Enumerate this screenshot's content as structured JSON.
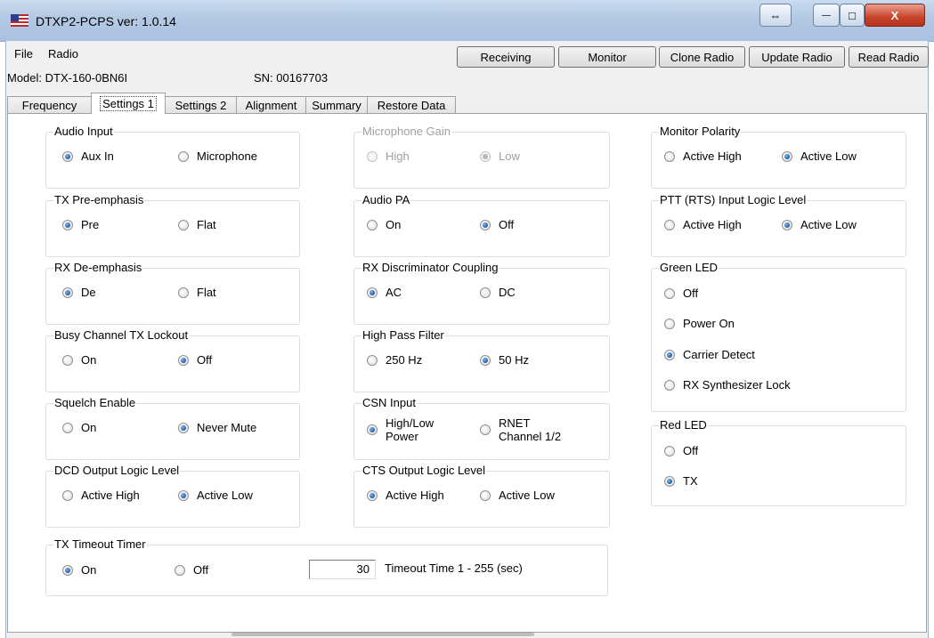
{
  "window": {
    "title": "DTXP2-PCPS ver: 1.0.14",
    "buttons": {
      "extra": "⇔",
      "minimize": "—",
      "maximize": "□",
      "close": "X"
    }
  },
  "menu": {
    "file": "File",
    "radio": "Radio"
  },
  "actions": {
    "receiving": "Receiving",
    "monitor": "Monitor",
    "clone": "Clone Radio",
    "update": "Update Radio",
    "read": "Read Radio"
  },
  "info": {
    "model": "Model: DTX-160-0BN6I",
    "sn": "SN: 00167703"
  },
  "tabs": [
    "Frequency",
    "Settings 1",
    "Settings 2",
    "Alignment",
    "Summary",
    "Restore Data"
  ],
  "groups": {
    "audio_input": {
      "label": "Audio Input",
      "options": [
        "Aux In",
        "Microphone"
      ],
      "selected": "Aux In"
    },
    "tx_preemphasis": {
      "label": "TX Pre-emphasis",
      "options": [
        "Pre",
        "Flat"
      ],
      "selected": "Pre"
    },
    "rx_deemphasis": {
      "label": "RX De-emphasis",
      "options": [
        "De",
        "Flat"
      ],
      "selected": "De"
    },
    "busy_channel": {
      "label": "Busy Channel TX Lockout",
      "options": [
        "On",
        "Off"
      ],
      "selected": "Off"
    },
    "squelch": {
      "label": "Squelch Enable",
      "options": [
        "On",
        "Never Mute"
      ],
      "selected": "Never Mute"
    },
    "dcd_output": {
      "label": "DCD Output Logic Level",
      "options": [
        "Active High",
        "Active Low"
      ],
      "selected": "Active Low"
    },
    "tx_timeout": {
      "label": "TX Timeout Timer",
      "options": [
        "On",
        "Off"
      ],
      "selected": "On",
      "value": "30",
      "value_label": "Timeout Time  1 - 255 (sec)"
    },
    "mic_gain": {
      "label": "Microphone Gain",
      "options": [
        "High",
        "Low"
      ],
      "selected": "Low",
      "disabled": true
    },
    "audio_pa": {
      "label": "Audio PA",
      "options": [
        "On",
        "Off"
      ],
      "selected": "Off"
    },
    "rx_disc": {
      "label": "RX Discriminator Coupling",
      "options": [
        "AC",
        "DC"
      ],
      "selected": "AC"
    },
    "hpf": {
      "label": "High Pass Filter",
      "options": [
        "250 Hz",
        "50 Hz"
      ],
      "selected": "50 Hz"
    },
    "csn_input": {
      "label": "CSN Input",
      "options": [
        "High/Low Power",
        "RNET Channel 1/2"
      ],
      "selected": "High/Low Power"
    },
    "cts_output": {
      "label": "CTS Output Logic Level",
      "options": [
        "Active High",
        "Active Low"
      ],
      "selected": "Active High"
    },
    "monitor_polarity": {
      "label": "Monitor Polarity",
      "options": [
        "Active High",
        "Active Low"
      ],
      "selected": "Active Low"
    },
    "ptt_input": {
      "label": "PTT (RTS) Input Logic Level",
      "options": [
        "Active High",
        "Active Low"
      ],
      "selected": "Active Low"
    },
    "green_led": {
      "label": "Green LED",
      "options": [
        "Off",
        "Power On",
        "Carrier Detect",
        "RX Synthesizer Lock"
      ],
      "selected": "Carrier Detect"
    },
    "red_led": {
      "label": "Red LED",
      "options": [
        "Off",
        "TX"
      ],
      "selected": "TX"
    }
  }
}
